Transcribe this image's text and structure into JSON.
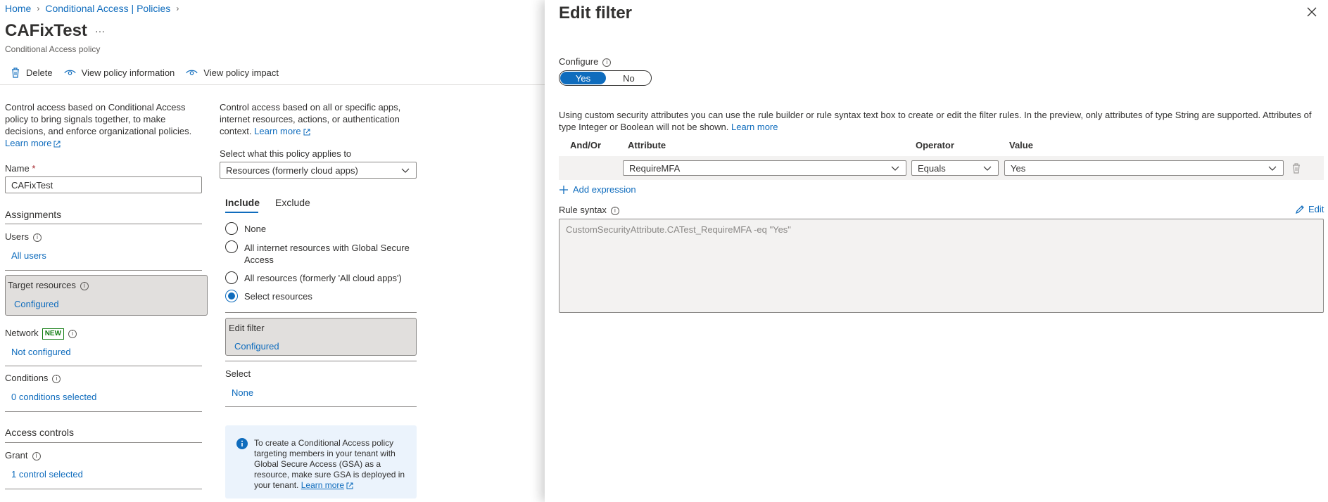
{
  "breadcrumb": {
    "home": "Home",
    "policies": "Conditional Access | Policies"
  },
  "policy": {
    "title": "CAFixTest",
    "ellipsis": "···",
    "subtitle": "Conditional Access policy"
  },
  "toolbar": {
    "delete": "Delete",
    "view_info": "View policy information",
    "view_impact": "View policy impact"
  },
  "left": {
    "description": "Control access based on Conditional Access policy to bring signals together, to make decisions, and enforce organizational policies.",
    "learn_more": "Learn more",
    "name_label": "Name",
    "required_star": "*",
    "name_value": "CAFixTest",
    "assignments": "Assignments",
    "users_label": "Users",
    "users_value": "All users",
    "target_label": "Target resources",
    "target_value": "Configured",
    "network_label": "Network",
    "network_badge": "NEW",
    "network_value": "Not configured",
    "conditions_label": "Conditions",
    "conditions_value": "0 conditions selected",
    "access_controls": "Access controls",
    "grant_label": "Grant",
    "grant_value": "1 control selected"
  },
  "middle": {
    "description": "Control access based on all or specific apps, internet resources, actions, or authentication context.",
    "learn_more": "Learn more",
    "select_label": "Select what this policy applies to",
    "select_value": "Resources (formerly cloud apps)",
    "tabs": [
      "Include",
      "Exclude"
    ],
    "radios": [
      {
        "label": "None",
        "checked": false
      },
      {
        "label": "All internet resources with Global Secure Access",
        "checked": false
      },
      {
        "label": "All resources (formerly 'All cloud apps')",
        "checked": false
      },
      {
        "label": "Select resources",
        "checked": true
      }
    ],
    "edit_filter_label": "Edit filter",
    "edit_filter_value": "Configured",
    "select_section_label": "Select",
    "select_section_value": "None",
    "info_text": "To create a Conditional Access policy targeting members in your tenant with Global Secure Access (GSA) as a resource, make sure GSA is deployed in your tenant.",
    "info_learn_more": "Learn more"
  },
  "panel": {
    "title": "Edit filter",
    "configure_label": "Configure",
    "toggle_yes": "Yes",
    "toggle_no": "No",
    "toggle_selected": "Yes",
    "description": "Using custom security attributes you can use the rule builder or rule syntax text box to create or edit the filter rules. In the preview, only attributes of type String are supported. Attributes of type Integer or Boolean will not be shown.",
    "learn_more": "Learn more",
    "columns": {
      "and_or": "And/Or",
      "attribute": "Attribute",
      "operator": "Operator",
      "value": "Value"
    },
    "row": {
      "attribute": "RequireMFA",
      "operator": "Equals",
      "value": "Yes"
    },
    "add_expression": "Add expression",
    "rule_syntax_label": "Rule syntax",
    "edit_label": "Edit",
    "rule_syntax_value": "CustomSecurityAttribute.CATest_RequireMFA -eq \"Yes\""
  },
  "colors": {
    "accent": "#0f6cbd",
    "selected_bg": "#e1dfdd",
    "info_bg": "#ebf3fc"
  }
}
